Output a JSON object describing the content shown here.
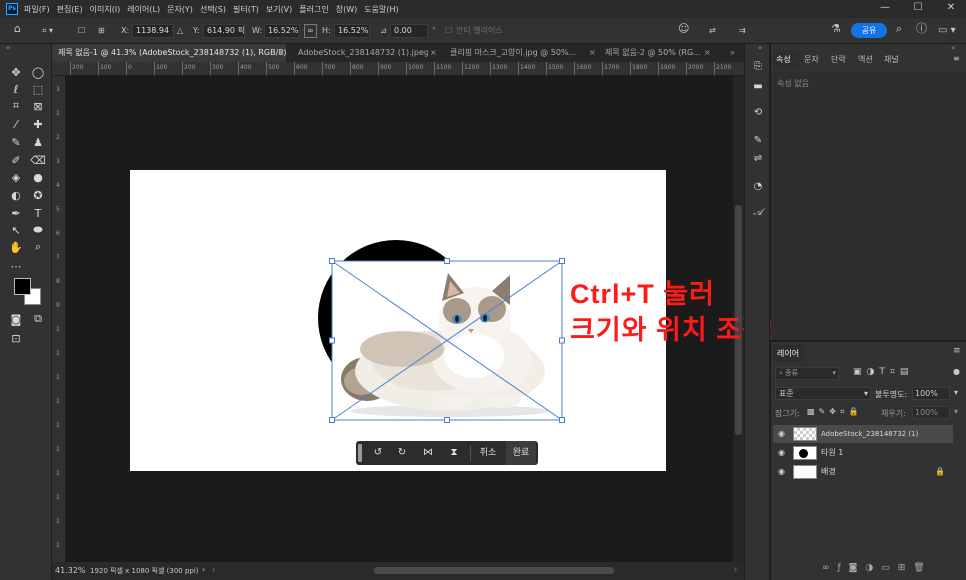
{
  "menubar": {
    "logo": "Ps",
    "items": [
      "파일(F)",
      "편집(E)",
      "이미지(I)",
      "레이어(L)",
      "문자(Y)",
      "선택(S)",
      "필터(T)",
      "보기(V)",
      "플러그인",
      "창(W)",
      "도움말(H)"
    ],
    "minimize": "—",
    "maximize": "☐",
    "close": "✕"
  },
  "options": {
    "x_label": "X:",
    "x_value": "1138.94 픽셀",
    "y_label": "Y:",
    "y_value": "614.90 픽셀",
    "w_label": "W:",
    "w_value": "16.52%",
    "h_label": "H:",
    "h_value": "16.52%",
    "angle_value": "0.00",
    "interp_label": "안티 앨리어스",
    "share_label": "공유"
  },
  "tabs": [
    {
      "label": "제목 없음-1 @ 41.3% (AdobeStock_238148732 (1), RGB/8) *",
      "active": true
    },
    {
      "label": "AdobeStock_238148732 (1).jpeg",
      "active": false
    },
    {
      "label": "클리핑 마스크_고양이.jpg @ 50%...",
      "active": false
    },
    {
      "label": "제목 없음-2 @ 50% (RG...",
      "active": false
    }
  ],
  "ruler": {
    "h_ticks": [
      "200",
      "100",
      "0",
      "100",
      "200",
      "300",
      "400",
      "500",
      "600",
      "700",
      "800",
      "900",
      "1000",
      "1100",
      "1200",
      "1300",
      "1400",
      "1500",
      "1600",
      "1700",
      "1800",
      "1900",
      "2000",
      "2100"
    ],
    "v_ticks": [
      "3",
      "1",
      "2",
      "3",
      "4",
      "5",
      "6",
      "7",
      "8",
      "9",
      "1",
      "1",
      "1",
      "1",
      "1",
      "1",
      "1",
      "1",
      "1",
      "1"
    ]
  },
  "status": {
    "zoom": "41.32%",
    "doc_info": "1920 픽셀 x 1080 픽셀 (300 ppi)",
    "arrow": "›"
  },
  "annotation": {
    "line1": "Ctrl+T 눌러",
    "line2": "크기와 위치 조정!"
  },
  "transform_bar": {
    "cancel_label": "취소",
    "confirm_label": "완료"
  },
  "properties": {
    "tabs": [
      "속성",
      "문자",
      "단락",
      "액션",
      "채널"
    ],
    "empty_text": "속성 없음"
  },
  "layers": {
    "title": "레이어",
    "search_placeholder": "종류",
    "blend_mode": "표준",
    "opacity_label": "불투명도:",
    "opacity_value": "100%",
    "lock_label": "잠그기:",
    "fill_label": "채우기:",
    "fill_value": "100%",
    "items": [
      {
        "name": "AdobeStock_238148732 (1)",
        "selected": true
      },
      {
        "name": "타원 1",
        "selected": false
      },
      {
        "name": "배경",
        "selected": false
      }
    ]
  },
  "colors": {
    "accent": "#1473e6",
    "annotation": "#ff1a1a",
    "transform_line": "#4a7fd6"
  }
}
